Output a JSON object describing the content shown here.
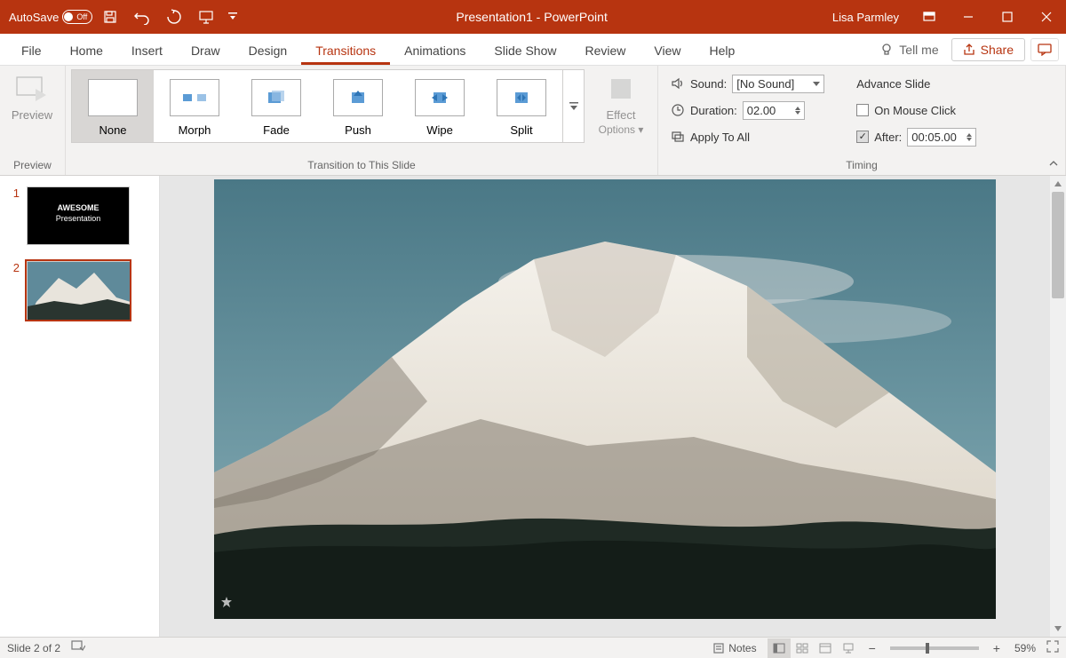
{
  "titlebar": {
    "autosave_label": "AutoSave",
    "autosave_state": "Off",
    "presentation_title": "Presentation1",
    "separator": " - ",
    "app_name": "PowerPoint",
    "user": "Lisa Parmley"
  },
  "tabs": {
    "file": "File",
    "items": [
      "Home",
      "Insert",
      "Draw",
      "Design",
      "Transitions",
      "Animations",
      "Slide Show",
      "Review",
      "View",
      "Help"
    ],
    "active": "Transitions",
    "tell_me": "Tell me",
    "share": "Share"
  },
  "ribbon": {
    "preview": {
      "label": "Preview",
      "group": "Preview"
    },
    "gallery": {
      "items": [
        "None",
        "Morph",
        "Fade",
        "Push",
        "Wipe",
        "Split"
      ],
      "selected": "None",
      "group": "Transition to This Slide"
    },
    "effect_options": "Effect Options ▾",
    "effect_options_l1": "Effect",
    "effect_options_l2": "Options ▾",
    "timing": {
      "sound_label": "Sound:",
      "sound_value": "[No Sound]",
      "duration_label": "Duration:",
      "duration_value": "02.00",
      "apply_all": "Apply To All",
      "advance_label": "Advance Slide",
      "on_click": "On Mouse Click",
      "after_label": "After:",
      "after_value": "00:05.00",
      "group": "Timing"
    }
  },
  "slides": {
    "thumb1_title": "AWESOME",
    "thumb1_sub": "Presentation",
    "nums": [
      "1",
      "2"
    ]
  },
  "status": {
    "slide_indicator": "Slide 2 of 2",
    "notes": "Notes",
    "zoom": "59%"
  }
}
